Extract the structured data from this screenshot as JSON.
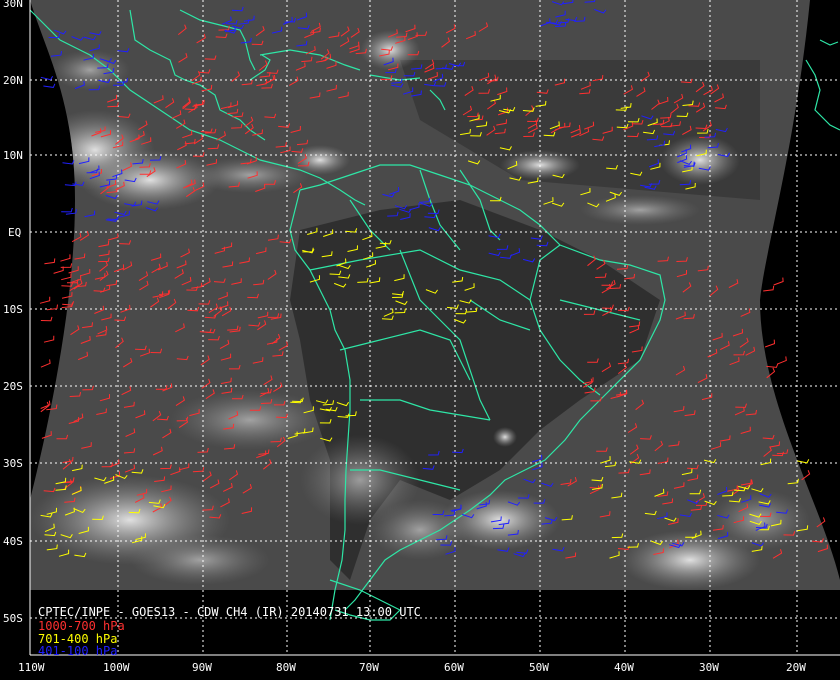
{
  "map": {
    "caption": "CPTEC/INPE - GOES13 - CDW CH4 (IR) 20140731 13:00 UTC",
    "latitude_labels": [
      "30N",
      "20N",
      "10N",
      "EQ",
      "10S",
      "20S",
      "30S",
      "40S",
      "50S"
    ],
    "longitude_labels": [
      "110W",
      "100W",
      "90W",
      "80W",
      "70W",
      "60W",
      "50W",
      "40W",
      "30W",
      "20W"
    ],
    "legend": [
      {
        "label": "1000-700 hPa",
        "color": "#ff3030"
      },
      {
        "label": "701-400 hPa",
        "color": "#ffff00"
      },
      {
        "label": "401-100 hPa",
        "color": "#2020ff"
      }
    ],
    "colors": {
      "coastline": "#2ee6a6",
      "gridline": "#ffffff",
      "background": "#000000",
      "satellite_disk": "#4a4a4a"
    }
  }
}
